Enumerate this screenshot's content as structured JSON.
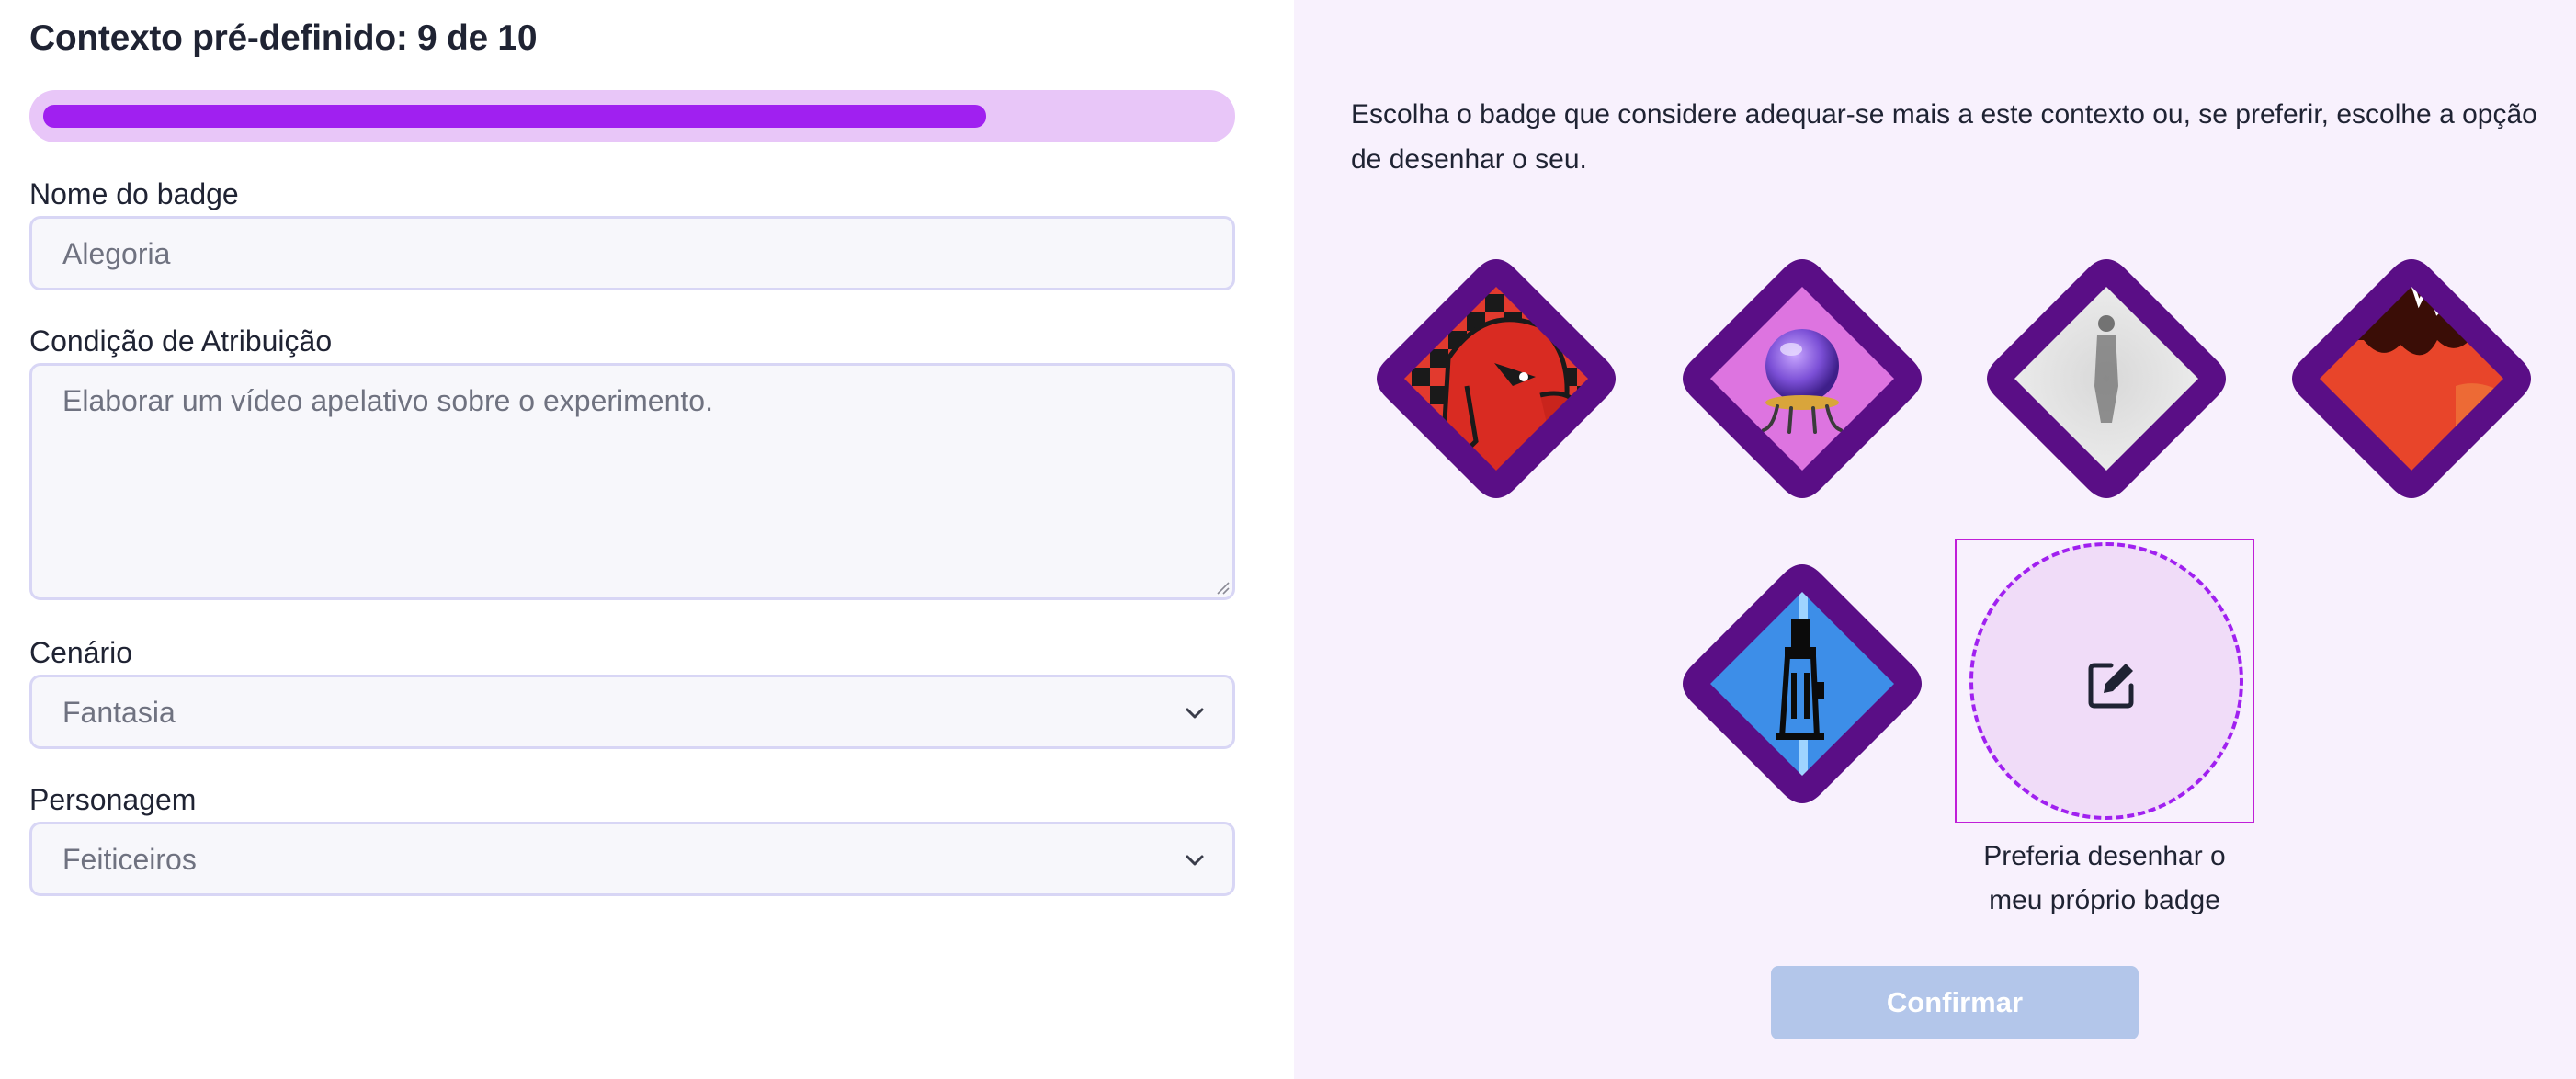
{
  "header": {
    "title": "Contexto pré-definido: 9 de 10"
  },
  "progress": {
    "current": 9,
    "total": 10,
    "fill_fraction": 0.8,
    "track_color": "#e8c6f8",
    "fill_color": "#a020f0"
  },
  "form": {
    "badge_name": {
      "label": "Nome do badge",
      "placeholder": "Alegoria"
    },
    "condition": {
      "label": "Condição de Atribuição",
      "placeholder": "Elaborar um vídeo apelativo sobre o experimento."
    },
    "scenario": {
      "label": "Cenário",
      "value": "Fantasia"
    },
    "character": {
      "label": "Personagem",
      "value": "Feiticeiros"
    }
  },
  "panel": {
    "instructions": "Escolha o badge que considere adequar-se mais a este contexto ou, se preferir, escolhe a opção de desenhar o seu.",
    "badges": [
      {
        "icon": "red-face-checker-badge-icon"
      },
      {
        "icon": "crystal-ball-badge-icon"
      },
      {
        "icon": "foggy-figure-badge-icon"
      },
      {
        "icon": "red-landscape-badge-icon"
      },
      {
        "icon": "pixel-wizard-badge-icon"
      }
    ],
    "custom_option": {
      "label": "Preferia desenhar o meu próprio badge",
      "icon": "edit-icon"
    },
    "confirm_label": "Confirmar"
  },
  "colors": {
    "badge_border": "#5a0e86",
    "accent": "#a020f0",
    "confirm_disabled": "#b3c6ea",
    "panel_bg": "#f8f1fd"
  }
}
